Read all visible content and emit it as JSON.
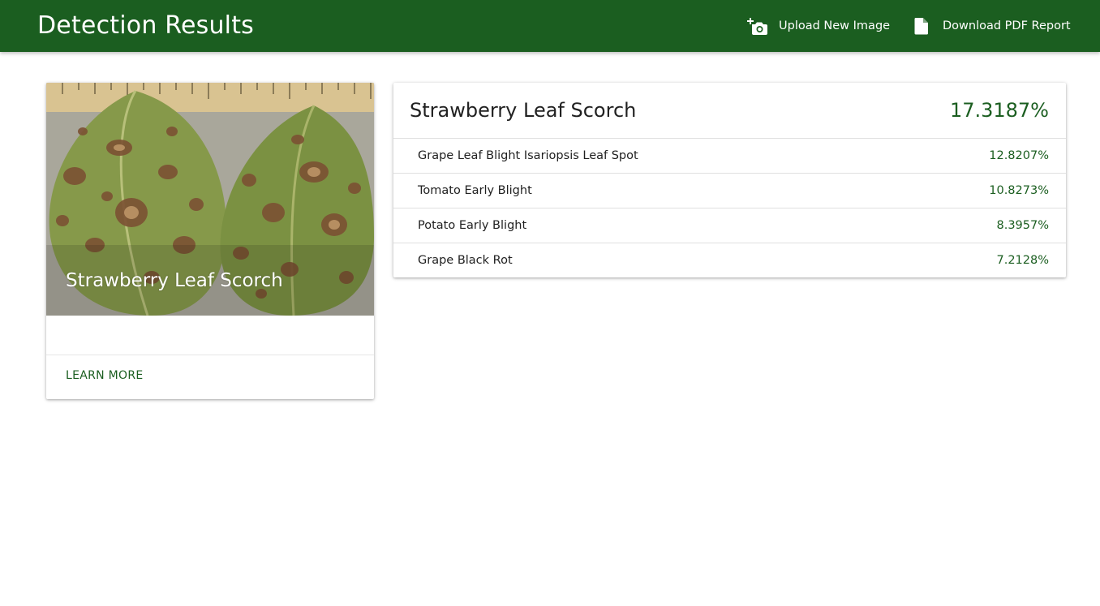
{
  "appbar": {
    "title": "Detection Results",
    "background_color": "#1b5e20",
    "actions": [
      {
        "label": "Upload New Image",
        "icon": "add-camera-icon"
      },
      {
        "label": "Download PDF Report",
        "icon": "file-icon"
      }
    ]
  },
  "image_card": {
    "image_caption": "Strawberry Leaf Scorch",
    "action_label": "LEARN MORE"
  },
  "results": {
    "top": {
      "name": "Strawberry Leaf Scorch",
      "confidence": "17.3187%"
    },
    "others": [
      {
        "name": "Grape Leaf Blight Isariopsis Leaf Spot",
        "confidence": "12.8207%"
      },
      {
        "name": "Tomato Early Blight",
        "confidence": "10.8273%"
      },
      {
        "name": "Potato Early Blight",
        "confidence": "8.3957%"
      },
      {
        "name": "Grape Black Rot",
        "confidence": "7.2128%"
      }
    ]
  },
  "colors": {
    "accent": "#1b5e20",
    "text": "#212121"
  }
}
